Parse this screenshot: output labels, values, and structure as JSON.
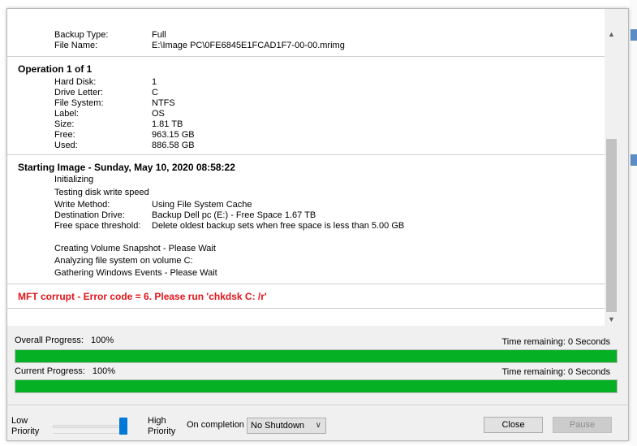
{
  "log": {
    "backup": [
      {
        "label": "Backup Type:",
        "value": "Full"
      },
      {
        "label": "File Name:",
        "value": "E:\\Image PC\\0FE6845E1FCAD1F7-00-00.mrimg"
      }
    ],
    "operation": {
      "title": "Operation 1 of 1",
      "rows": [
        {
          "label": "Hard Disk:",
          "value": "1"
        },
        {
          "label": "Drive Letter:",
          "value": "C"
        },
        {
          "label": "File System:",
          "value": "NTFS"
        },
        {
          "label": "Label:",
          "value": "OS"
        },
        {
          "label": "Size:",
          "value": "1.81 TB"
        },
        {
          "label": "Free:",
          "value": "963.15 GB"
        },
        {
          "label": "Used:",
          "value": "886.58 GB"
        }
      ]
    },
    "image": {
      "title": "Starting Image - Sunday, May 10, 2020 08:58:22",
      "initializing": "Initializing",
      "testing": "Testing disk write speed",
      "rows": [
        {
          "label": "Write Method:",
          "value": "Using File System Cache"
        },
        {
          "label": "Destination Drive:",
          "value": "Backup Dell pc (E:) - Free Space 1.67 TB"
        },
        {
          "label": "Free space threshold:",
          "value": "Delete oldest backup sets when free space is less than 5.00 GB"
        }
      ],
      "messages": [
        "Creating Volume Snapshot - Please Wait",
        "Analyzing file system on volume C:",
        "Gathering Windows Events - Please Wait"
      ]
    },
    "error": "MFT corrupt - Error code = 6. Please run 'chkdsk C: /r'"
  },
  "progress": {
    "overall": {
      "label": "Overall Progress:",
      "percent_text": "100%",
      "time": "Time remaining: 0 Seconds",
      "fraction": 1.0
    },
    "current": {
      "label": "Current Progress:",
      "percent_text": "100%",
      "time": "Time remaining: 0 Seconds",
      "fraction": 1.0
    }
  },
  "priority": {
    "low": "Low",
    "high": "High",
    "priority_word": "Priority",
    "level": 1.0
  },
  "completion": {
    "label": "On completion",
    "selected": "No Shutdown"
  },
  "buttons": {
    "close": "Close",
    "pause": "Pause"
  },
  "colors": {
    "progress": "#06b025",
    "error": "#e0141a",
    "accent": "#0078d7"
  }
}
